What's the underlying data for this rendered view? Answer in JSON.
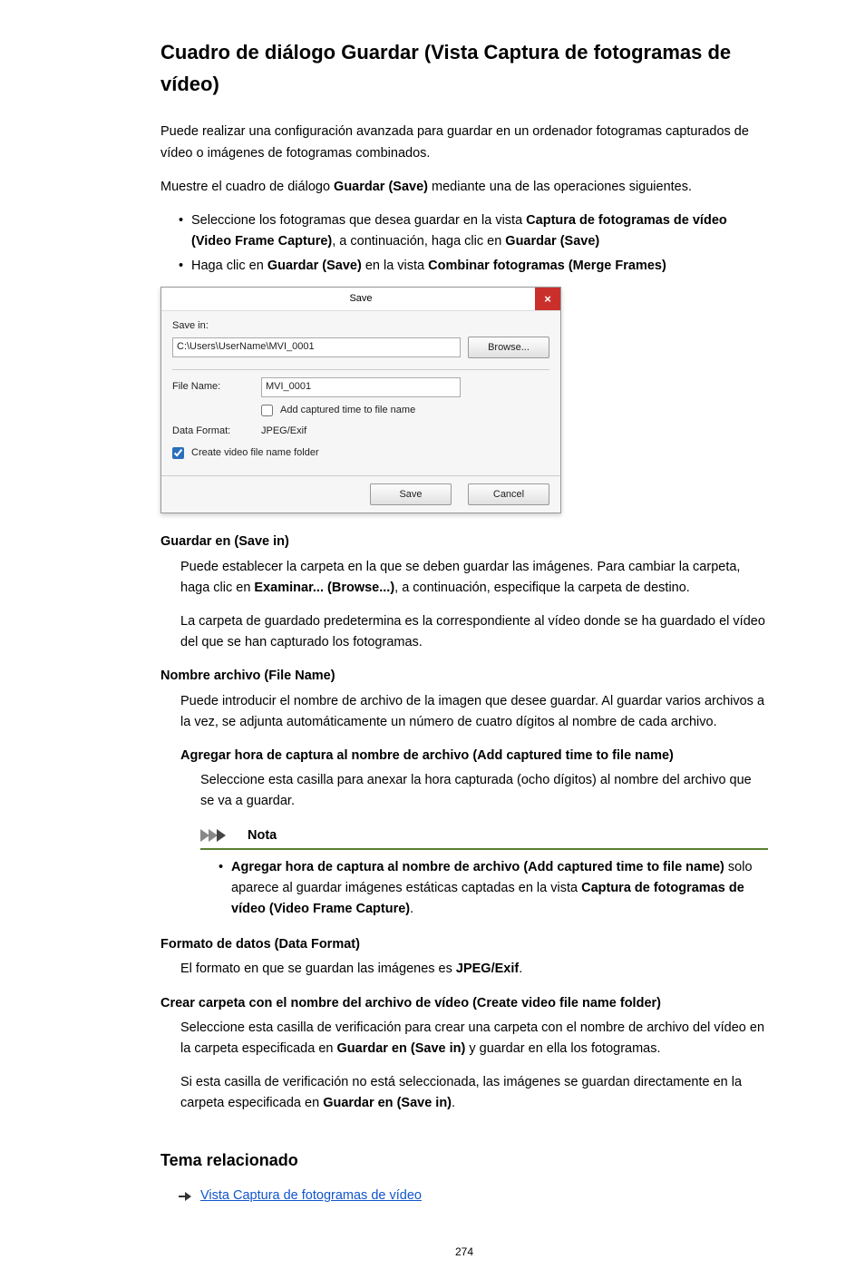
{
  "title": "Cuadro de diálogo Guardar (Vista Captura de fotogramas de vídeo)",
  "intro": {
    "p1": "Puede realizar una configuración avanzada para guardar en un ordenador fotogramas capturados de vídeo o imágenes de fotogramas combinados.",
    "p2a": "Muestre el cuadro de diálogo ",
    "p2b": "Guardar (Save)",
    "p2c": " mediante una de las operaciones siguientes."
  },
  "oplist": {
    "i1a": "Seleccione los fotogramas que desea guardar en la vista ",
    "i1b": "Captura de fotogramas de vídeo (Video Frame Capture)",
    "i1c": ", a continuación, haga clic en ",
    "i1d": "Guardar (Save)",
    "i2a": "Haga clic en ",
    "i2b": "Guardar (Save)",
    "i2c": " en la vista ",
    "i2d": "Combinar fotogramas (Merge Frames)"
  },
  "dlg": {
    "title": "Save",
    "close": "×",
    "savein_lbl": "Save in:",
    "savein_path": "C:\\Users\\UserName\\MVI_0001",
    "browse": "Browse...",
    "filename_lbl": "File Name:",
    "filename_val": "MVI_0001",
    "addtime": "Add captured time to file name",
    "dataformat_lbl": "Data Format:",
    "dataformat_val": "JPEG/Exif",
    "createfolder": "Create video file name folder",
    "btn_save": "Save",
    "btn_cancel": "Cancel"
  },
  "def": {
    "savein_t": "Guardar en (Save in)",
    "savein_p1a": "Puede establecer la carpeta en la que se deben guardar las imágenes. Para cambiar la carpeta, haga clic en ",
    "savein_p1b": "Examinar... (Browse...)",
    "savein_p1c": ", a continuación, especifique la carpeta de destino.",
    "savein_p2": "La carpeta de guardado predetermina es la correspondiente al vídeo donde se ha guardado el vídeo del que se han capturado los fotogramas.",
    "fname_t": "Nombre archivo (File Name)",
    "fname_p": "Puede introducir el nombre de archivo de la imagen que desee guardar. Al guardar varios archivos a la vez, se adjunta automáticamente un número de cuatro dígitos al nombre de cada archivo.",
    "addtime_t": "Agregar hora de captura al nombre de archivo (Add captured time to file name)",
    "addtime_p": "Seleccione esta casilla para anexar la hora capturada (ocho dígitos) al nombre del archivo que se va a guardar.",
    "note_t": "Nota",
    "note_i_a": "Agregar hora de captura al nombre de archivo (Add captured time to file name)",
    "note_i_b": " solo aparece al guardar imágenes estáticas captadas en la vista ",
    "note_i_c": "Captura de fotogramas de vídeo (Video Frame Capture)",
    "note_i_d": ".",
    "dformat_t": "Formato de datos (Data Format)",
    "dformat_pa": "El formato en que se guardan las imágenes es ",
    "dformat_pb": "JPEG/Exif",
    "dformat_pc": ".",
    "create_t": "Crear carpeta con el nombre del archivo de vídeo (Create video file name folder)",
    "create_p1a": "Seleccione esta casilla de verificación para crear una carpeta con el nombre de archivo del vídeo en la carpeta especificada en ",
    "create_p1b": "Guardar en (Save in)",
    "create_p1c": " y guardar en ella los fotogramas.",
    "create_p2a": "Si esta casilla de verificación no está seleccionada, las imágenes se guardan directamente en la carpeta especificada en ",
    "create_p2b": "Guardar en (Save in)",
    "create_p2c": "."
  },
  "related_h": "Tema relacionado",
  "related_link": "Vista Captura de fotogramas de vídeo",
  "pagenum": "274"
}
